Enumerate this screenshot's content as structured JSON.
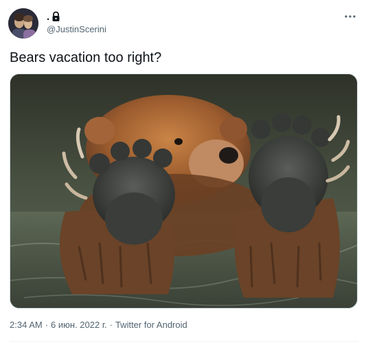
{
  "author": {
    "display_name": ".",
    "handle": "@JustinScerini",
    "protected_icon": "lock-icon",
    "avatar_icon": "profile-photo"
  },
  "more_menu": {
    "icon": "more-horizontal-icon",
    "label": "..."
  },
  "tweet": {
    "text": "Bears vacation too right?",
    "media": {
      "icon": "bear-photo",
      "description_colors": {
        "fur": "#b5713a",
        "paw_pads": "#3a3d3a",
        "water": "#4f5948"
      }
    }
  },
  "metadata": {
    "time": "2:34 AM",
    "separator": "·",
    "date": "6 июн. 2022 г.",
    "source": "Twitter for Android"
  },
  "colors": {
    "text_primary": "#0f1419",
    "text_secondary": "#536471",
    "border": "#cfd9de"
  }
}
